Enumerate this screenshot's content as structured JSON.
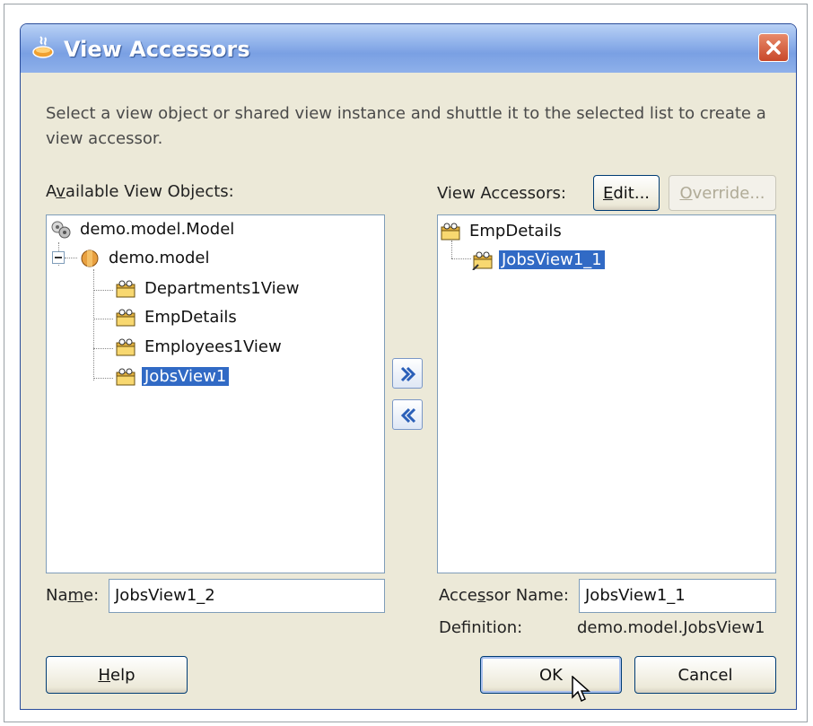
{
  "dialog": {
    "title": "View Accessors",
    "description": "Select a view object or shared view instance and shuttle it to the selected list to create a view accessor."
  },
  "available": {
    "label_pre": "A",
    "label_u": "v",
    "label_post": "ailable View Objects:",
    "tree": {
      "root": "demo.model.Model",
      "package": "demo.model",
      "items": [
        "Departments1View",
        "EmpDetails",
        "Employees1View",
        "JobsView1"
      ],
      "selected_item": "JobsView1"
    },
    "name_label_pre": "Na",
    "name_label_u": "m",
    "name_label_post": "e:",
    "name_value": "JobsView1_2"
  },
  "shuttle": {
    "add_icon": "double-chevron-right-icon",
    "remove_icon": "double-chevron-left-icon"
  },
  "accessors": {
    "label": "View Accessors:",
    "edit_pre": "",
    "edit_u": "E",
    "edit_post": "dit...",
    "override_pre": "",
    "override_u": "O",
    "override_post": "verride...",
    "tree": {
      "parent": "EmpDetails",
      "child": "JobsView1_1"
    },
    "accessor_name_pre": "Acce",
    "accessor_name_u": "s",
    "accessor_name_post": "sor Name:",
    "accessor_name_value": "JobsView1_1",
    "definition_label": "Definition:",
    "definition_value": "demo.model.JobsView1"
  },
  "footer": {
    "help_pre": "",
    "help_u": "H",
    "help_post": "elp",
    "ok": "OK",
    "cancel": "Cancel"
  },
  "colors": {
    "selection": "#316ac5",
    "titlebar": "#7aa0e3",
    "dialog_bg": "#ece9d8"
  }
}
